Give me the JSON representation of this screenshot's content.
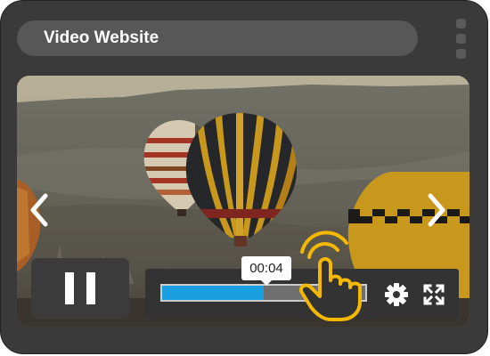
{
  "header": {
    "title": "Video Website",
    "menu_icon": "kebab-menu-icon"
  },
  "player": {
    "current_time": "00:04",
    "progress": 0.5,
    "state": "playing",
    "play_pause_icon": "pause-icon",
    "prev_icon": "chevron-left-icon",
    "next_icon": "chevron-right-icon",
    "settings_icon": "gear-icon",
    "fullscreen_icon": "fullscreen-icon",
    "cursor_icon": "hand-pointer-icon"
  },
  "colors": {
    "progress_fill": "#1aa0e0",
    "cursor_accent": "#f5b800"
  }
}
